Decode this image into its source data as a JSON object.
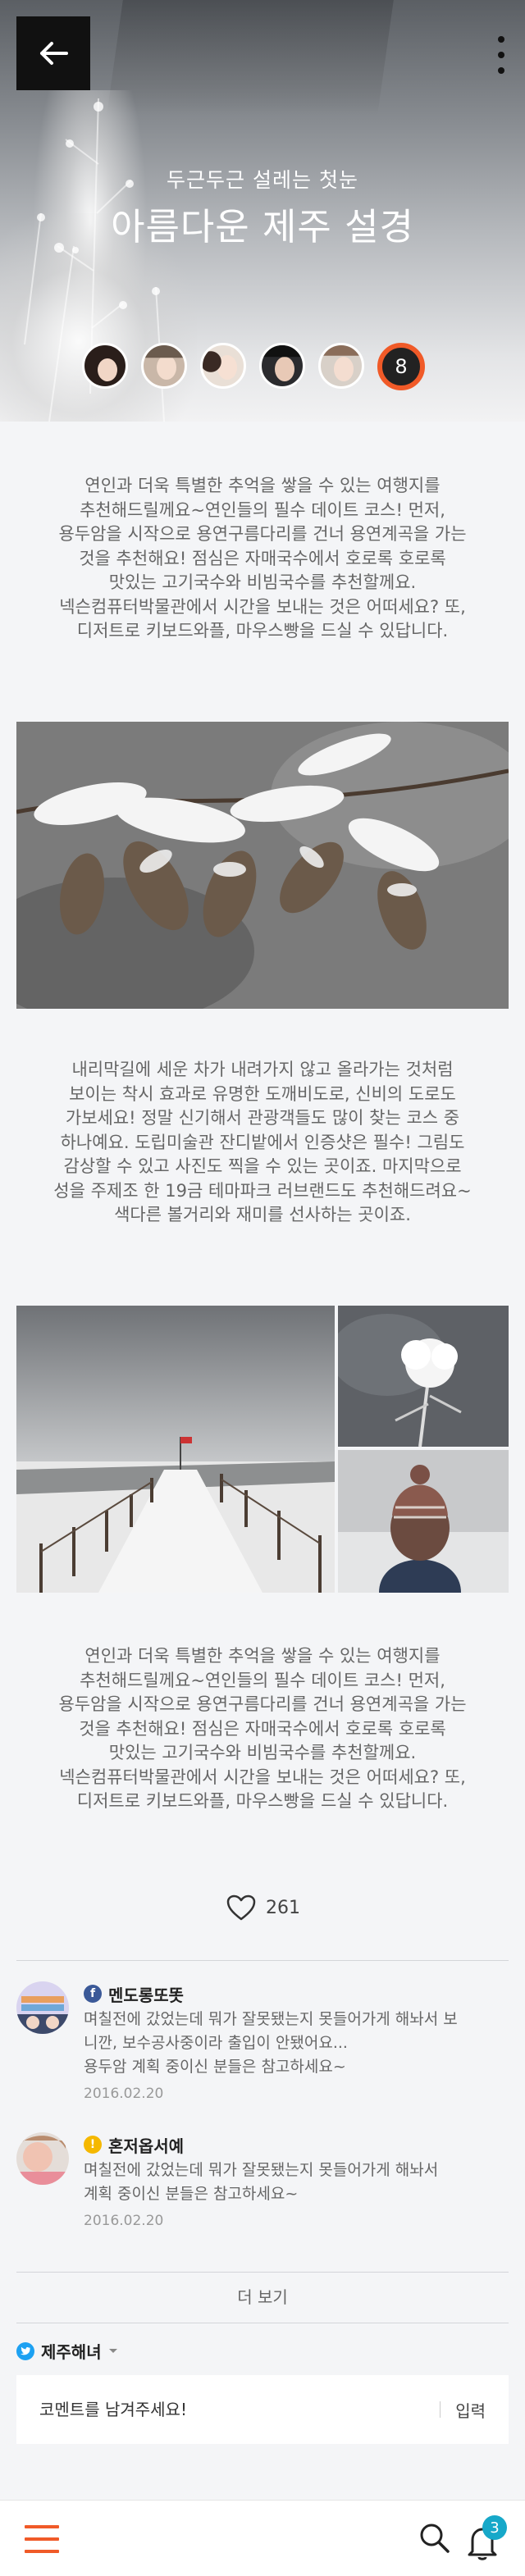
{
  "hero": {
    "subtitle": "두근두근 설레는 첫눈",
    "title": "아름다운 제주 설경",
    "participant_count": "8"
  },
  "paragraphs": [
    "연인과 더욱 특별한 추억을 쌓을 수 있는 여행지를\n추천해드릴께요~연인들의 필수 데이트 코스! 먼저,\n용두암을 시작으로 용연구름다리를 건너 용연계곡을 가는\n것을 추천해요! 점심은 자매국수에서 호로록 호로록\n맛있는 고기국수와 비빔국수를 추천할께요.\n넥슨컴퓨터박물관에서 시간을 보내는 것은 어떠세요? 또,\n디저트로 키보드와플, 마우스빵을 드실 수 있답니다.",
    "내리막길에 세운 차가 내려가지 않고 올라가는 것처럼\n보이는 착시 효과로 유명한 도깨비도로, 신비의 도로도\n가보세요! 정말 신기해서 관광객들도 많이 찾는 코스 중\n하나예요. 도립미술관 잔디밭에서 인증샷은 필수! 그림도\n감상할 수 있고 사진도 찍을 수 있는 곳이죠. 마지막으로\n성을 주제조 한 19금 테마파크 러브랜드도 추천해드려요~\n색다른 볼거리와 재미를 선사하는 곳이죠.",
    "연인과 더욱 특별한 추억을 쌓을 수 있는 여행지를\n추천해드릴께요~연인들의 필수 데이트 코스! 먼저,\n용두암을 시작으로 용연구름다리를 건너 용연계곡을 가는\n것을 추천해요! 점심은 자매국수에서 호로록 호로록\n맛있는 고기국수와 비빔국수를 추천할께요.\n넥슨컴퓨터박물관에서 시간을 보내는 것은 어떠세요? 또,\n디저트로 키보드와플, 마우스빵을 드실 수 있답니다."
  ],
  "like": {
    "count": "261",
    "icon": "heart-outline-icon"
  },
  "comments": [
    {
      "name": "멘도롱또똣",
      "sns": "facebook",
      "sns_color": "#3b5998",
      "text": "며칠전에 갔었는데 뭐가 잘못됐는지 못들어가게 해놔서 보\n니깐, 보수공사중이라 출입이 안됐어요...\n용두암 계획 중이신 분들은 참고하세요~",
      "date": "2016.02.20"
    },
    {
      "name": "혼저옵서예",
      "sns": "kakao",
      "sns_color": "#f5b800",
      "text": "며칠전에 갔었는데 뭐가 잘못됐는지 못들어가게 해놔서\n계획 중이신 분들은 참고하세요~",
      "date": "2016.02.20"
    }
  ],
  "more_comments_label": "더 보기",
  "writer": {
    "name": "제주해녀",
    "sns": "twitter",
    "sns_color": "#1da1f2"
  },
  "comment_form": {
    "placeholder": "코멘트를 남겨주세요!",
    "submit_label": "입력"
  },
  "bottom_bar": {
    "notification_count": "3"
  },
  "colors": {
    "accent": "#f05a28",
    "badge": "#17a8c9",
    "background": "#f4f5f7"
  }
}
